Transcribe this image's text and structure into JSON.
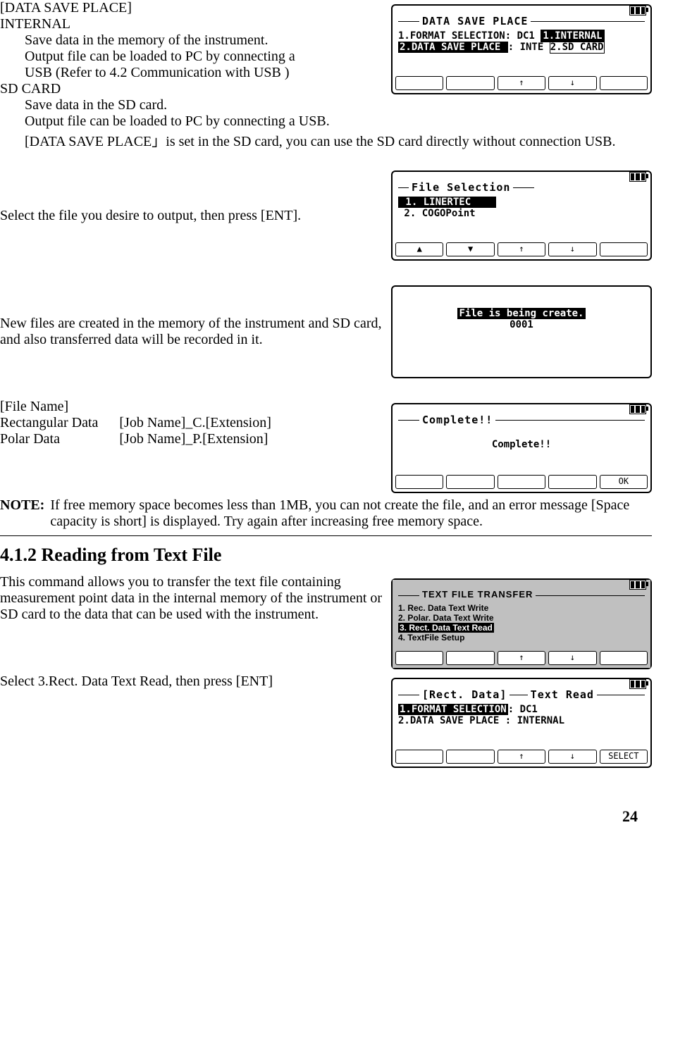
{
  "s1": {
    "heading": "[DATA SAVE PLACE]",
    "opt1": "INTERNAL",
    "opt1_l1": "Save data in the memory of the instrument.",
    "opt1_l2": "Output file can be loaded to PC by connecting a",
    "opt1_l3": "USB (Refer to 4.2 Communication with USB )",
    "opt2": "SD CARD",
    "opt2_l1": "Save data in the SD card.",
    "opt2_l2": "Output file can be loaded to PC by connecting a USB.",
    "opt2_l3": "[DATA SAVE PLACE」is set in the SD card, you can use the SD card directly without connection USB.",
    "scr_title": "DATA SAVE PLACE",
    "scr_l1a": "1.FORMAT SELECTION",
    "scr_l1b": ": DC1",
    "scr_l1c": "1.INTERNAL",
    "scr_l2a": "2.DATA SAVE PLACE ",
    "scr_l2b": ": INTE",
    "scr_l2c": "2.SD CARD"
  },
  "s2": {
    "text": "Select the file you desire to output, then press [ENT].",
    "scr_title": "File Selection",
    "scr_l1": " 1. LINERTEC    ",
    "scr_l2": " 2. COGOPoint"
  },
  "s3": {
    "text": "New files are created in the memory of the instrument and SD card, and also transferred data will be recorded in it.",
    "scr_msg": "File is being create.",
    "scr_num": "0001"
  },
  "s4": {
    "heading": "[File Name]",
    "r1c1": "Rectangular Data",
    "r1c2": "[Job Name]_C.[Extension]",
    "r2c1": "Polar Data",
    "r2c2": "[Job Name]_P.[Extension]",
    "scr_title": "Complete!!",
    "scr_msg": "Complete!!",
    "scr_ok": "OK"
  },
  "note": {
    "label": "NOTE:",
    "text": "If free memory space becomes less than 1MB, you can not create the file, and an error message [Space capacity is short] is displayed. Try again after increasing free memory space."
  },
  "h2": "4.1.2 Reading from Text File",
  "s5": {
    "text": "This command allows you to transfer the text file containing measurement point data in the internal memory of the instrument or SD card to the data that can be used with the instrument.",
    "scr_title": "TEXT FILE TRANSFER",
    "scr_l1": "1. Rec. Data Text Write",
    "scr_l2": "2. Polar. Data Text Write",
    "scr_l3": "3. Rect. Data Text Read",
    "scr_l4": "4. TextFile Setup"
  },
  "s6": {
    "text": "Select 3.Rect. Data Text Read, then press [ENT]",
    "scr_title_l": "[Rect. Data]",
    "scr_title_r": "Text Read",
    "scr_l1a": "1.FORMAT SELECTION",
    "scr_l1b": ": DC1",
    "scr_l2a": "2.DATA SAVE PLACE ",
    "scr_l2b": ": INTERNAL",
    "scr_select": "SELECT"
  },
  "arrows": {
    "up": "↑",
    "down": "↓",
    "tup": "▲",
    "tdown": "▼"
  },
  "page": "24"
}
